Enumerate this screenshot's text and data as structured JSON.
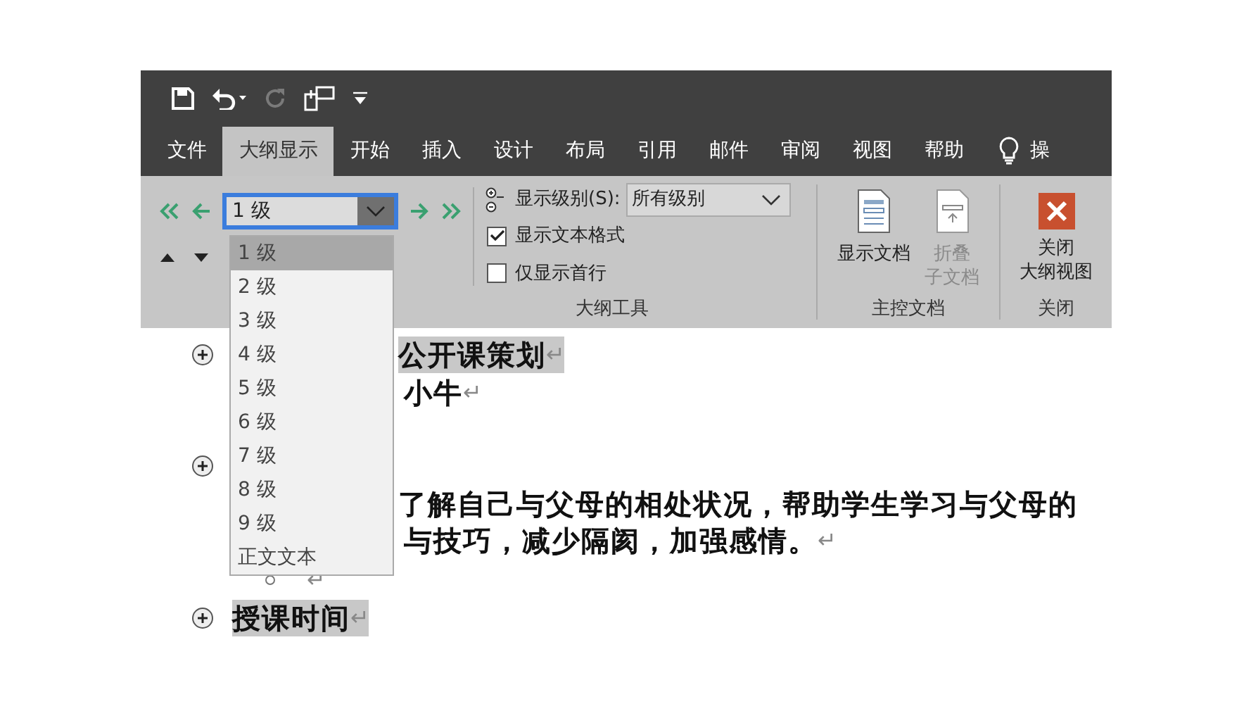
{
  "quick_access": [
    {
      "kind": "save",
      "disabled": false
    },
    {
      "kind": "undo",
      "disabled": false
    },
    {
      "kind": "redo",
      "disabled": true
    },
    {
      "kind": "touch",
      "disabled": false
    },
    {
      "kind": "customize",
      "disabled": false
    }
  ],
  "tabs": [
    {
      "label": "文件",
      "selected": false
    },
    {
      "label": "大纲显示",
      "selected": true
    },
    {
      "label": "开始",
      "selected": false
    },
    {
      "label": "插入",
      "selected": false
    },
    {
      "label": "设计",
      "selected": false
    },
    {
      "label": "布局",
      "selected": false
    },
    {
      "label": "引用",
      "selected": false
    },
    {
      "label": "邮件",
      "selected": false
    },
    {
      "label": "审阅",
      "selected": false
    },
    {
      "label": "视图",
      "selected": false
    },
    {
      "label": "帮助",
      "selected": false
    }
  ],
  "tell_me": "操",
  "outline_tools": {
    "level_combo": {
      "value": "1 级",
      "open": true
    },
    "level_list": [
      {
        "label": "1 级",
        "selected": true
      },
      {
        "label": "2 级",
        "selected": false
      },
      {
        "label": "3 级",
        "selected": false
      },
      {
        "label": "4 级",
        "selected": false
      },
      {
        "label": "5 级",
        "selected": false
      },
      {
        "label": "6 级",
        "selected": false
      },
      {
        "label": "7 级",
        "selected": false
      },
      {
        "label": "8 级",
        "selected": false
      },
      {
        "label": "9 级",
        "selected": false
      },
      {
        "label": "正文文本",
        "selected": false
      }
    ],
    "show_level": {
      "label": "显示级别(S):",
      "value": "所有级别"
    },
    "options": [
      {
        "label": "显示文本格式",
        "checked": true
      },
      {
        "label": "仅显示首行",
        "checked": false
      }
    ],
    "group_label": "大纲工具"
  },
  "master_document": {
    "buttons": [
      {
        "kind": "show",
        "lines": [
          "显示文档"
        ],
        "disabled": false
      },
      {
        "kind": "collapse",
        "lines": [
          "折叠",
          "子文档"
        ],
        "disabled": true
      }
    ],
    "group_label": "主控文档"
  },
  "close": {
    "button_lines": [
      "关闭",
      "大纲视图"
    ],
    "group_label": "关闭"
  },
  "document": {
    "paragraphs": [
      {
        "kind": "heading",
        "text": "公开课策划",
        "mark": "↵",
        "highlighted": true
      },
      {
        "kind": "body",
        "text": "小牛",
        "mark": "↵",
        "highlighted": false
      },
      {
        "kind": "heading"
      },
      {
        "kind": "body",
        "text": "了解自己与父母的相处状况，帮助学生学习与父母的",
        "highlighted": false
      },
      {
        "kind": "body",
        "text": "与技巧，减少隔阂，加强感情。",
        "mark": "↵",
        "highlighted": false
      },
      {
        "kind": "empty",
        "mark": "↵",
        "highlighted": false
      },
      {
        "kind": "heading",
        "text": "授课时间",
        "mark": "↵",
        "highlighted": true
      }
    ]
  }
}
